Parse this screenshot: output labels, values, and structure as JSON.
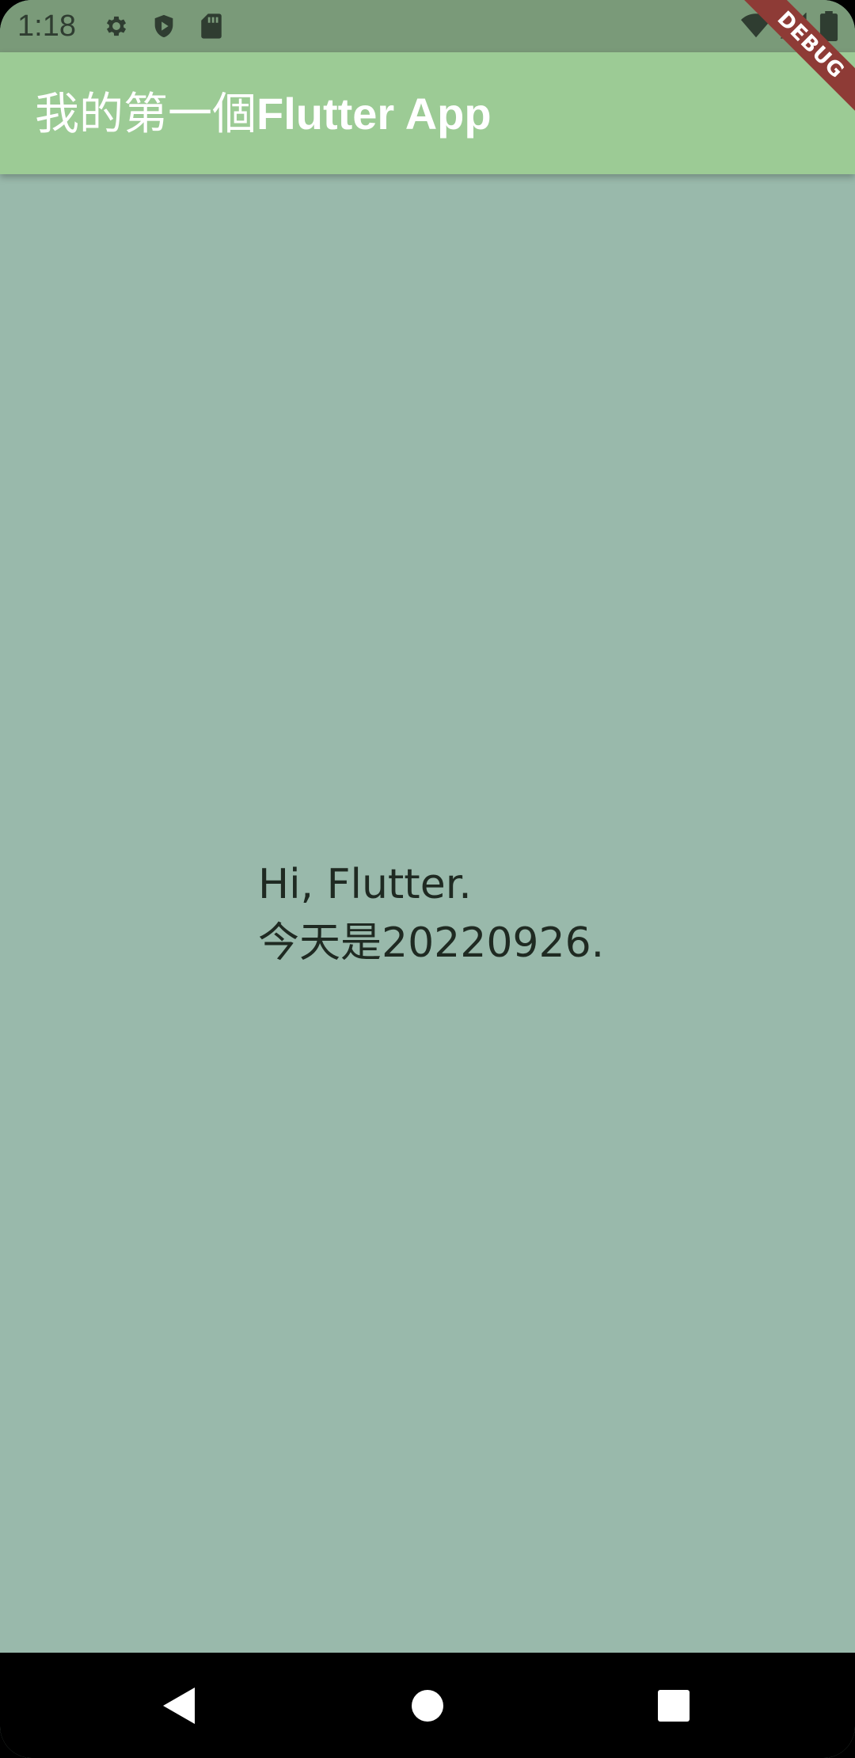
{
  "status_bar": {
    "time": "1:18",
    "left_icons": [
      "gear-icon",
      "shield-play-icon",
      "sd-card-icon"
    ],
    "right_icons": [
      "wifi-icon",
      "cell-signal-icon",
      "battery-icon"
    ]
  },
  "app_bar": {
    "title_cjk": "我的第一個",
    "title_latin": "Flutter App"
  },
  "body": {
    "line1": "Hi, Flutter.",
    "line2": "今天是20220926."
  },
  "debug_banner": {
    "label": "DEBUG"
  },
  "nav_bar": {
    "buttons": [
      "back-icon",
      "home-icon",
      "recents-icon"
    ]
  },
  "colors": {
    "status_bar": "#7a9a79",
    "app_bar": "#9ccb95",
    "background": "#99b9ab",
    "debug_ribbon": "#8e3b36",
    "nav_bar": "#000000"
  }
}
